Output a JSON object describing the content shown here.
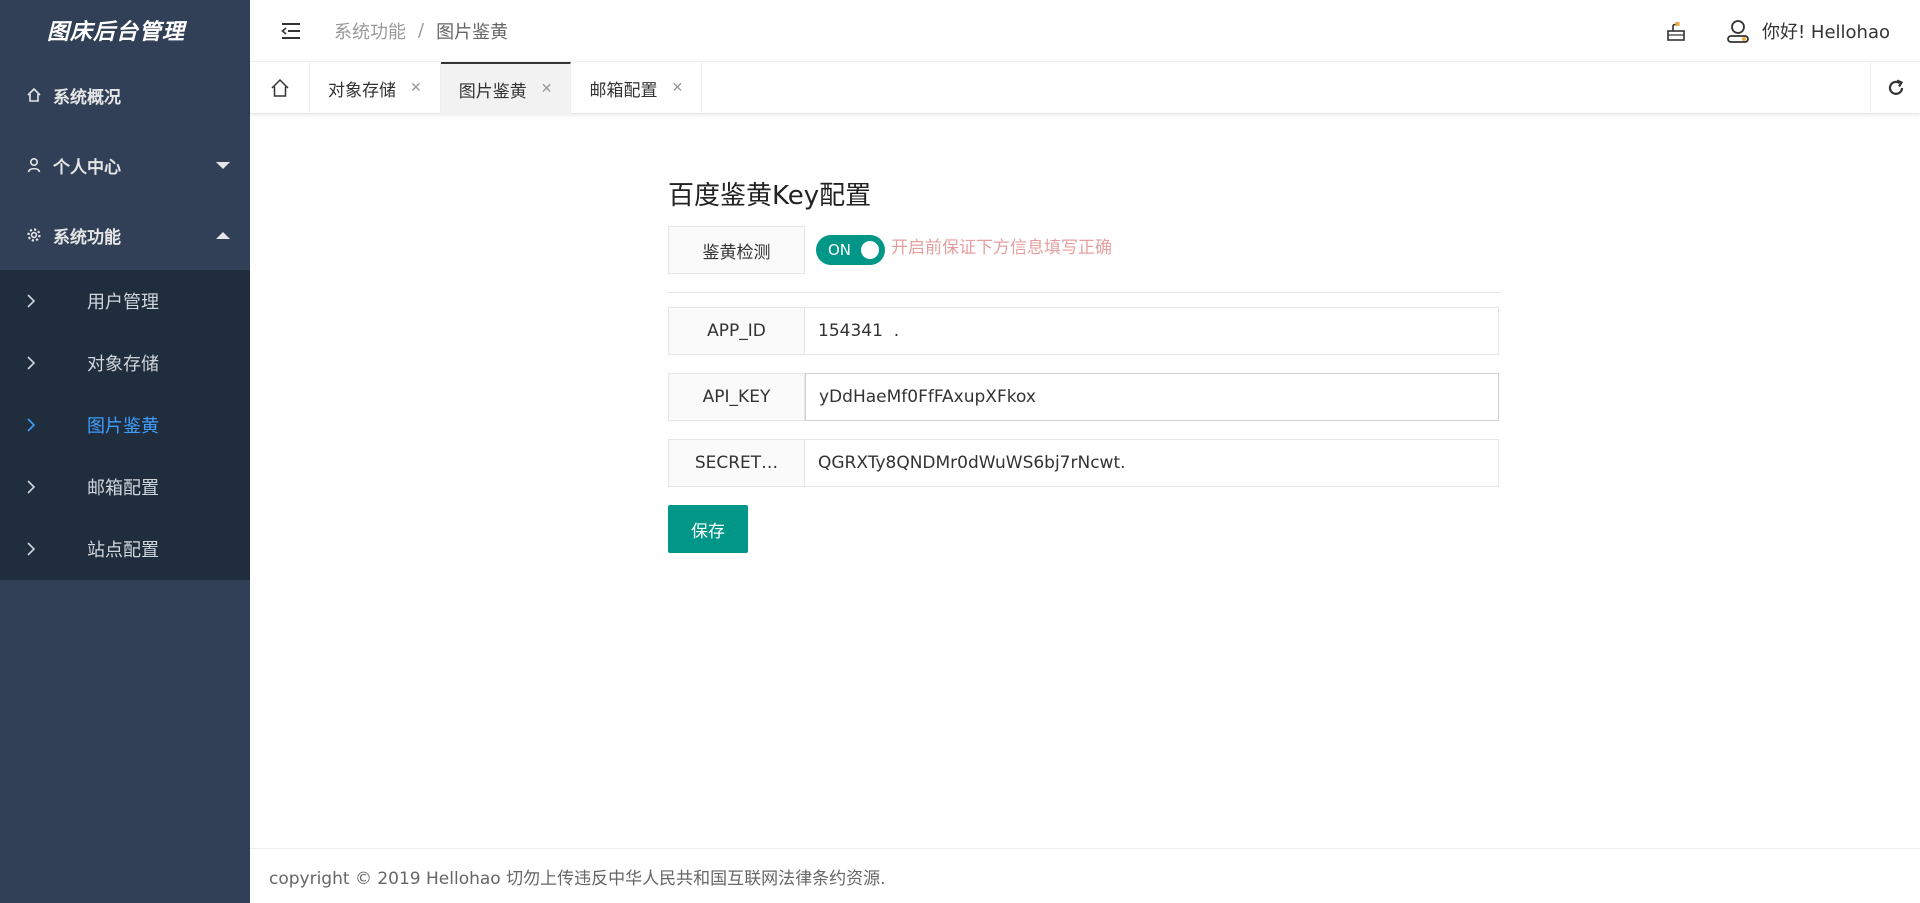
{
  "sidebar": {
    "logo": "图床后台管理",
    "menus": [
      {
        "label": "系统概况",
        "icon": "home-icon"
      },
      {
        "label": "个人中心",
        "icon": "user-icon",
        "expanded": false
      },
      {
        "label": "系统功能",
        "icon": "gear-icon",
        "expanded": true
      }
    ],
    "sub_items": [
      {
        "label": "用户管理"
      },
      {
        "label": "对象存储"
      },
      {
        "label": "图片鉴黄"
      },
      {
        "label": "邮箱配置"
      },
      {
        "label": "站点配置"
      }
    ]
  },
  "header": {
    "breadcrumb": [
      "系统功能",
      "图片鉴黄"
    ],
    "breadcrumb_sep": "/",
    "greeting": "你好!  Hellohao"
  },
  "tabs": {
    "items": [
      {
        "label": "对象存储",
        "close": "✕"
      },
      {
        "label": "图片鉴黄",
        "close": "✕"
      },
      {
        "label": "邮箱配置",
        "close": "✕"
      }
    ]
  },
  "main": {
    "title": "百度鉴黄Key配置",
    "detect_label": "鉴黄检测",
    "switch_text": "ON",
    "hint": "开启前保证下方信息填写正确",
    "fields": [
      {
        "label": "APP_ID",
        "value": "154341  ."
      },
      {
        "label": "API_KEY",
        "value": "yDdHaeMf0FfFAxupXFkox"
      },
      {
        "label": "SECRET…",
        "value": "QGRXTy8QNDMr0dWuWS6bj7rNcwt."
      }
    ],
    "save_label": "保存"
  },
  "footer": {
    "text": "copyright © 2019 Hellohao 切勿上传违反中华人民共和国互联网法律条约资源."
  },
  "colors": {
    "sidebar_bg": "#324057",
    "submenu_bg": "#1f2d3d",
    "active_link": "#409eff",
    "primary": "#009688",
    "hint": "#e4a0a0"
  }
}
